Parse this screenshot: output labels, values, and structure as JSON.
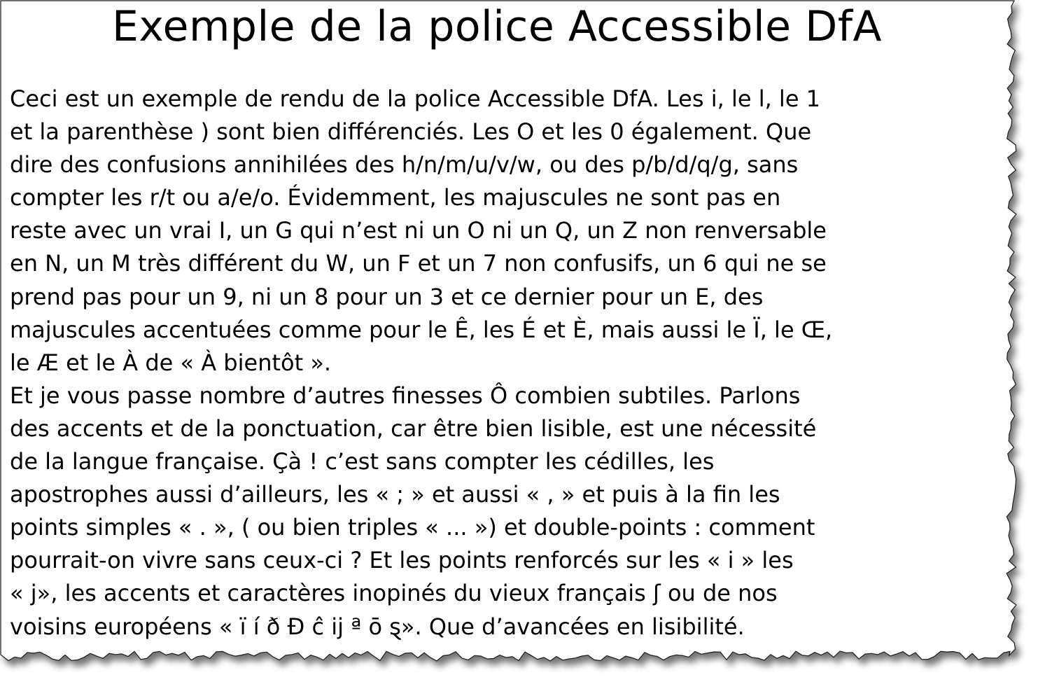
{
  "document": {
    "title": "Exemple de la police Accessible DfA",
    "lines": [
      "Ceci est un exemple de rendu de la police Accessible DfA. Les i, le l, le 1",
      "et la parenthèse ) sont bien différenciés. Les O et les 0 également. Que",
      "dire des confusions annihilées des h/n/m/u/v/w, ou des p/b/d/q/g, sans",
      "compter les r/t ou a/e/o. Évidemment, les majuscules ne sont pas en",
      "reste avec un vrai I, un G qui n’est ni un O ni un Q, un Z non renversable",
      "en N, un M très différent du W, un F et un 7 non confusifs, un 6 qui ne se",
      "prend pas pour un 9, ni un 8 pour un 3 et ce dernier pour un E, des",
      "majuscules accentuées comme pour le Ê, les É et È, mais aussi le Ï, le Œ,",
      "le Æ et le À de « À bientôt ».",
      "Et je vous passe nombre d’autres finesses Ô combien subtiles. Parlons",
      "des accents et de la ponctuation, car être bien lisible, est une nécessité",
      "de la langue française. Çà ! c’est sans compter les cédilles, les",
      "apostrophes aussi d’ailleurs, les « ; » et aussi « , » et puis à la fin les",
      "points simples « . », ( ou bien triples « ... ») et double-points : comment",
      "pourrait-on vivre sans ceux-ci ? Et les points renforcés sur les « i » les",
      "« j», les accents et caractères inopinés du vieux français ʃ ou de nos",
      "voisins européens « ï í ð Đ ĉ ĳ ª ō ȿ». Que d’avancées en lisibilité."
    ]
  }
}
